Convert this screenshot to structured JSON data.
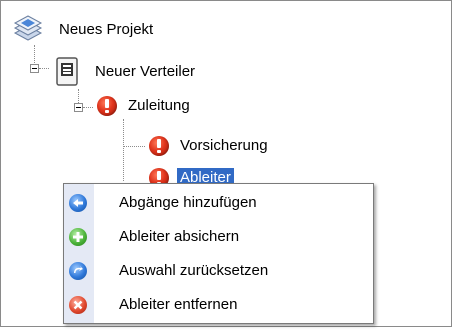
{
  "tree": {
    "root": {
      "label": "Neues Projekt",
      "icon": "project-stack-icon"
    },
    "distributor": {
      "label": "Neuer Verteiler",
      "icon": "distributor-icon"
    },
    "feed": {
      "label": "Zuleitung",
      "icon": "warning-icon"
    },
    "children": [
      {
        "label": "Vorsicherung",
        "icon": "warning-icon"
      },
      {
        "label": "Ableiter",
        "icon": "warning-icon",
        "selected": true
      }
    ]
  },
  "context_menu": {
    "items": [
      {
        "label": "Abgänge hinzufügen",
        "icon": "arrow-left-icon",
        "color": "#2f78d9"
      },
      {
        "label": "Ableiter absichern",
        "icon": "add-icon",
        "color": "#4bb33a"
      },
      {
        "label": "Auswahl zurücksetzen",
        "icon": "reset-icon",
        "color": "#2f78d9"
      },
      {
        "label": "Ableiter entfernen",
        "icon": "remove-icon",
        "color": "#e0482e"
      }
    ]
  }
}
